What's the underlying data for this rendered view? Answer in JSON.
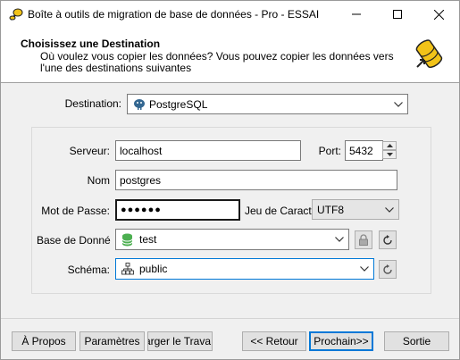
{
  "window": {
    "title": "Boîte à outils de migration de base de données - Pro - ESSAI"
  },
  "header": {
    "title": "Choisissez une Destination",
    "description": "Où voulez vous copier les données? Vous pouvez copier les données vers l'une des destinations suivantes"
  },
  "destination": {
    "label": "Destination:",
    "value": "PostgreSQL"
  },
  "form": {
    "server_label": "Serveur:",
    "server_value": "localhost",
    "port_label": "Port:",
    "port_value": "5432",
    "name_label": "Nom",
    "name_value": "postgres",
    "password_label": "Mot de Passe:",
    "password_value": "●●●●●●",
    "charset_label": "Jeu de Caract",
    "charset_value": "UTF8",
    "database_label": "Base de Donné",
    "database_value": "test",
    "schema_label": "Schéma:",
    "schema_value": "public"
  },
  "buttons": {
    "about": "À Propos",
    "settings": "Paramètres",
    "load_job": "harger le Trava",
    "back": "<< Retour",
    "next": "Prochain>>",
    "exit": "Sortie"
  },
  "colors": {
    "accent": "#0078d7",
    "icon_yellow": "#f2c318"
  }
}
